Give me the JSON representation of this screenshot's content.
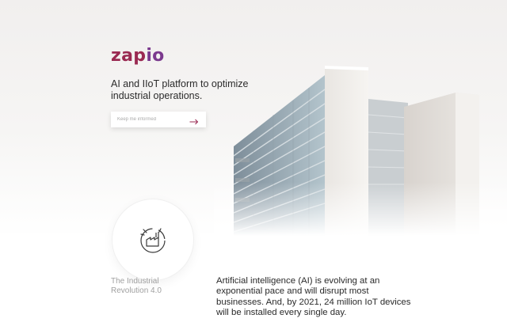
{
  "brand": {
    "logo_text_main": "zap",
    "logo_text_accent": "io",
    "logo_color": "#9a2a52",
    "logo_accent_color": "#7b3a8e"
  },
  "hero": {
    "tagline": "AI and IIoT platform to optimize industrial operations.",
    "image": "office-building-photo"
  },
  "signup": {
    "placeholder": "Keep me informed",
    "submit_icon": "arrow-right-icon"
  },
  "feature": {
    "icon": "factory-icon",
    "caption": "The Industrial Revolution 4.0"
  },
  "intro": {
    "paragraph": "Artificial intelligence (AI) is evolving at an exponential pace and will disrupt most businesses. And, by 2021, 24 million IoT devices will be installed every single day."
  }
}
